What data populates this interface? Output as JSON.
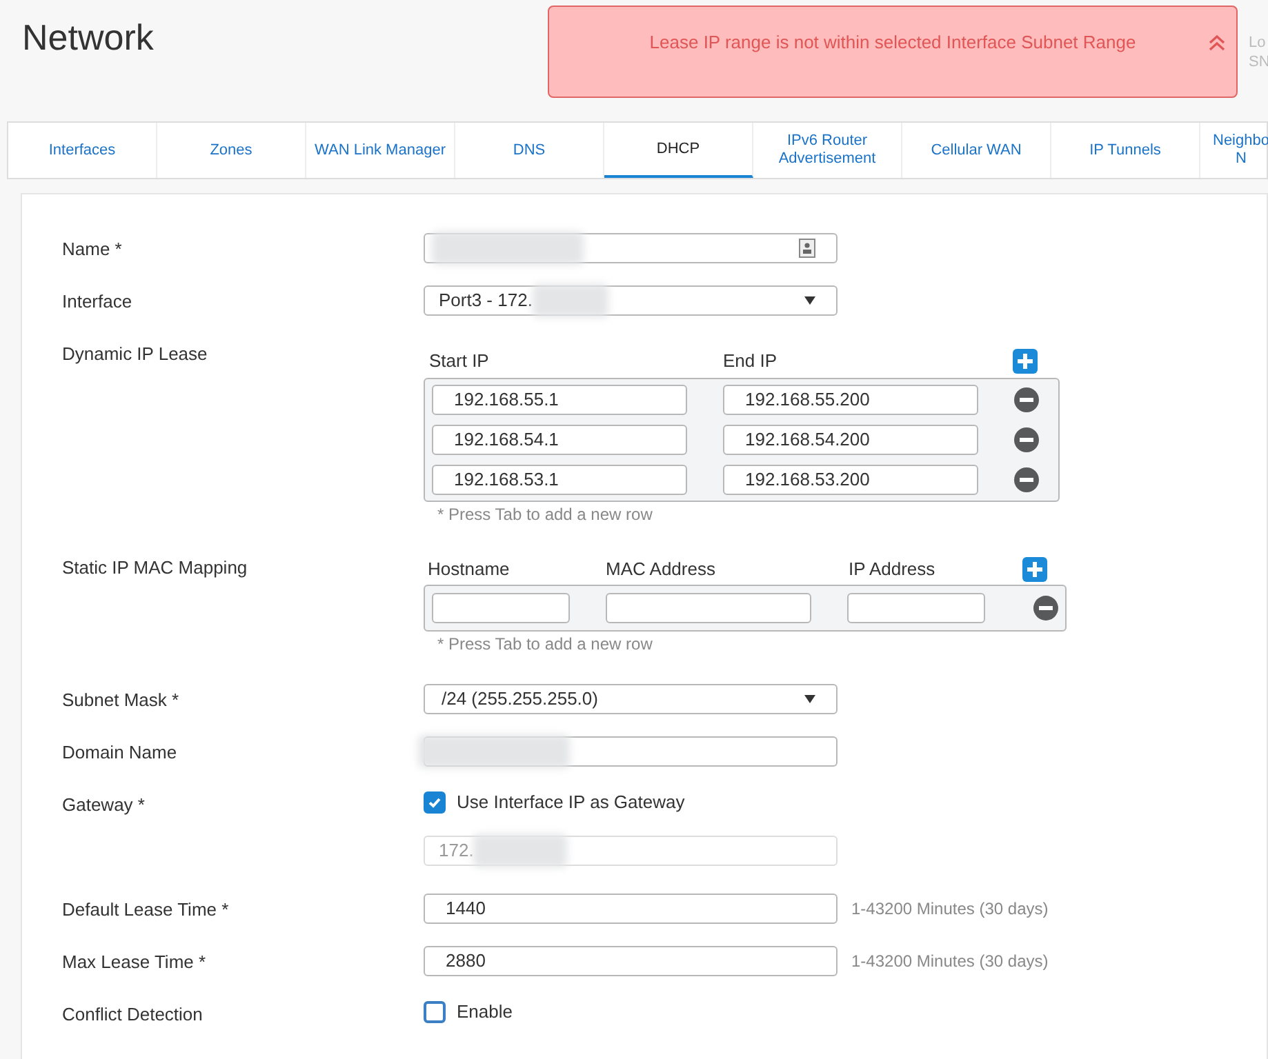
{
  "title": "Network",
  "alert": {
    "message": "Lease IP range is not within selected Interface Subnet Range"
  },
  "header_corner": [
    "Lo",
    "SN"
  ],
  "tabs": [
    {
      "label": "Interfaces",
      "selected": false
    },
    {
      "label": "Zones",
      "selected": false
    },
    {
      "label": "WAN Link Manager",
      "selected": false
    },
    {
      "label": "DNS",
      "selected": false
    },
    {
      "label": "DHCP",
      "selected": true
    },
    {
      "label": "IPv6 Router Advertisement",
      "selected": false
    },
    {
      "label": "Cellular WAN",
      "selected": false
    },
    {
      "label": "IP Tunnels",
      "selected": false
    },
    {
      "label": "Neighbo N",
      "selected": false
    }
  ],
  "name": {
    "label": "Name *"
  },
  "interface": {
    "label": "Interface",
    "value": "Port3 - 172."
  },
  "dynamic_ip_lease": {
    "label": "Dynamic IP Lease",
    "columns": [
      "Start IP",
      "End IP"
    ],
    "rows": [
      {
        "start": "192.168.55.1",
        "end": "192.168.55.200"
      },
      {
        "start": "192.168.54.1",
        "end": "192.168.54.200"
      },
      {
        "start": "192.168.53.1",
        "end": "192.168.53.200"
      }
    ],
    "hint": "* Press Tab to add a new row"
  },
  "static_ip_mac_mapping": {
    "label": "Static IP MAC Mapping",
    "columns": [
      "Hostname",
      "MAC Address",
      "IP Address"
    ],
    "hint": "* Press Tab to add a new row"
  },
  "subnet_mask": {
    "label": "Subnet Mask *",
    "value": "/24 (255.255.255.0)"
  },
  "domain_name": {
    "label": "Domain Name"
  },
  "gateway": {
    "label": "Gateway *",
    "checkbox": {
      "label": "Use Interface IP as Gateway",
      "checked": true
    },
    "ip": {
      "value": "172.",
      "disabled": true
    }
  },
  "default_lease_time": {
    "label": "Default Lease Time *",
    "value": "1440",
    "hint": "1-43200 Minutes (30 days)"
  },
  "max_lease_time": {
    "label": "Max Lease Time *",
    "value": "2880",
    "hint": "1-43200 Minutes (30 days)"
  },
  "conflict_detection": {
    "label": "Conflict Detection",
    "checkbox": {
      "label": "Enable",
      "checked": false
    }
  }
}
